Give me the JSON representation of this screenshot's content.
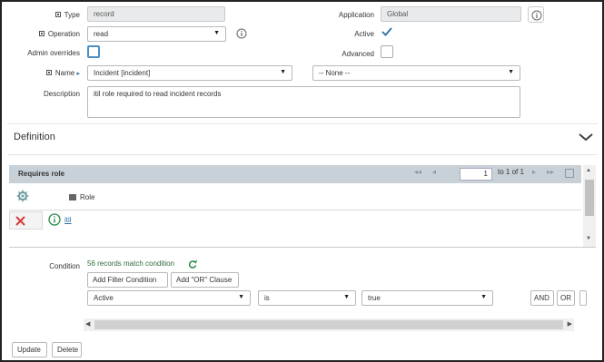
{
  "form": {
    "type": {
      "label": "Type",
      "value": "record"
    },
    "application": {
      "label": "Application",
      "value": "Global"
    },
    "operation": {
      "label": "Operation",
      "value": "read"
    },
    "active": {
      "label": "Active",
      "checked": true
    },
    "admin_overrides": {
      "label": "Admin overrides",
      "checked": false
    },
    "advanced": {
      "label": "Advanced",
      "checked": false
    },
    "name": {
      "label": "Name",
      "table_value": "Incident [incident]",
      "field_value": "-- None --"
    },
    "description": {
      "label": "Description",
      "value": "itil role required to read incident records"
    }
  },
  "definition": {
    "title": "Definition"
  },
  "requires_role": {
    "title": "Requires role",
    "pager": {
      "current": "1",
      "range_text": "to 1 of 1"
    },
    "column_header": "Role",
    "rows": [
      {
        "role": "itil"
      }
    ]
  },
  "condition": {
    "label": "Condition",
    "match_text": "56 records match condition",
    "add_filter_label": "Add Filter Condition",
    "add_or_label": "Add \"OR\" Clause",
    "field": "Active",
    "operator": "is",
    "value": "true",
    "and_label": "AND",
    "or_label": "OR"
  },
  "actions": {
    "update_label": "Update",
    "delete_label": "Delete"
  },
  "colors": {
    "list_header": "#c9d1d8",
    "check": "#2e6ea0",
    "delete_x": "#d9393e",
    "info": "#2a8a4a"
  }
}
